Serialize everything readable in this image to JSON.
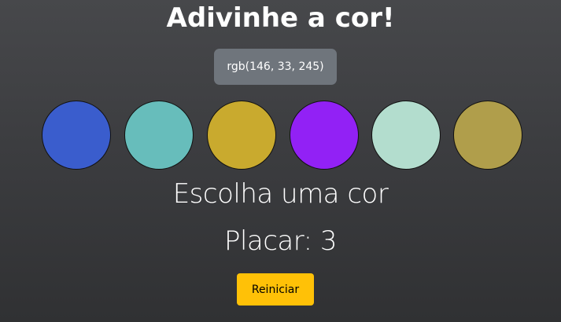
{
  "header": {
    "title": "Adivinhe a cor!"
  },
  "target": {
    "rgb_label": "rgb(146, 33, 245)"
  },
  "swatches": [
    {
      "color": "#3a5dcd"
    },
    {
      "color": "#67bdbb"
    },
    {
      "color": "#c9aa2e"
    },
    {
      "color": "#9221f5"
    },
    {
      "color": "#b3ddce"
    },
    {
      "color": "#b09e4b"
    }
  ],
  "status": {
    "message": "Escolha uma cor",
    "score_label": "Placar: 3"
  },
  "controls": {
    "restart_label": "Reiniciar"
  },
  "colors": {
    "target_pill_bg": "#6f757c",
    "restart_button_bg": "#ffc107"
  }
}
